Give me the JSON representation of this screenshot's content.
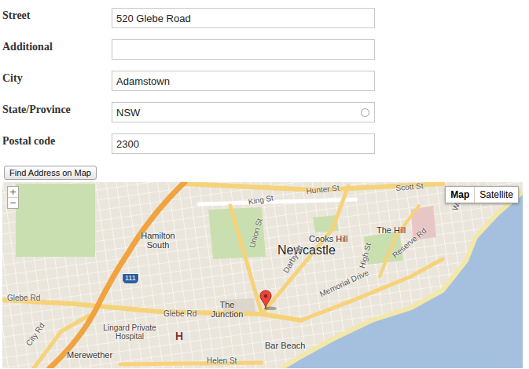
{
  "form": {
    "fields": [
      {
        "label": "Street",
        "value": "520 Glebe Road",
        "kind": "text"
      },
      {
        "label": "Additional",
        "value": "",
        "kind": "text"
      },
      {
        "label": "City",
        "value": "Adamstown",
        "kind": "text"
      },
      {
        "label": "State/Province",
        "value": "NSW",
        "kind": "select"
      },
      {
        "label": "Postal code",
        "value": "2300",
        "kind": "text"
      }
    ],
    "button": "Find Address on Map"
  },
  "map": {
    "zoom": [
      "+",
      "−"
    ],
    "types": [
      {
        "label": "Map",
        "selected": true
      },
      {
        "label": "Satellite",
        "selected": false
      }
    ],
    "labels": [
      {
        "text": "Scott St",
        "kind": "street"
      },
      {
        "text": "Hunter St",
        "kind": "street"
      },
      {
        "text": "King St",
        "kind": "street"
      },
      {
        "text": "Hamilton South",
        "kind": "suburb"
      },
      {
        "text": "Newcastle",
        "kind": "city"
      },
      {
        "text": "Cooks Hill",
        "kind": "suburb"
      },
      {
        "text": "The Hill",
        "kind": "suburb"
      },
      {
        "text": "Union St",
        "kind": "street"
      },
      {
        "text": "Darby St",
        "kind": "street"
      },
      {
        "text": "Reserve Rd",
        "kind": "street"
      },
      {
        "text": "High St",
        "kind": "street"
      },
      {
        "text": "Watt St",
        "kind": "street"
      },
      {
        "text": "111",
        "kind": "shield"
      },
      {
        "text": "Glebe Rd",
        "kind": "street"
      },
      {
        "text": "Glebe Rd",
        "kind": "street"
      },
      {
        "text": "The Junction",
        "kind": "suburb"
      },
      {
        "text": "Memorial Drive",
        "kind": "street"
      },
      {
        "text": "Lingard Private Hospital",
        "kind": "poi"
      },
      {
        "text": "H",
        "kind": "hospital"
      },
      {
        "text": "Merewether",
        "kind": "suburb"
      },
      {
        "text": "Bar Beach",
        "kind": "suburb"
      },
      {
        "text": "Helen St",
        "kind": "street"
      },
      {
        "text": "City Rd",
        "kind": "street"
      }
    ]
  }
}
